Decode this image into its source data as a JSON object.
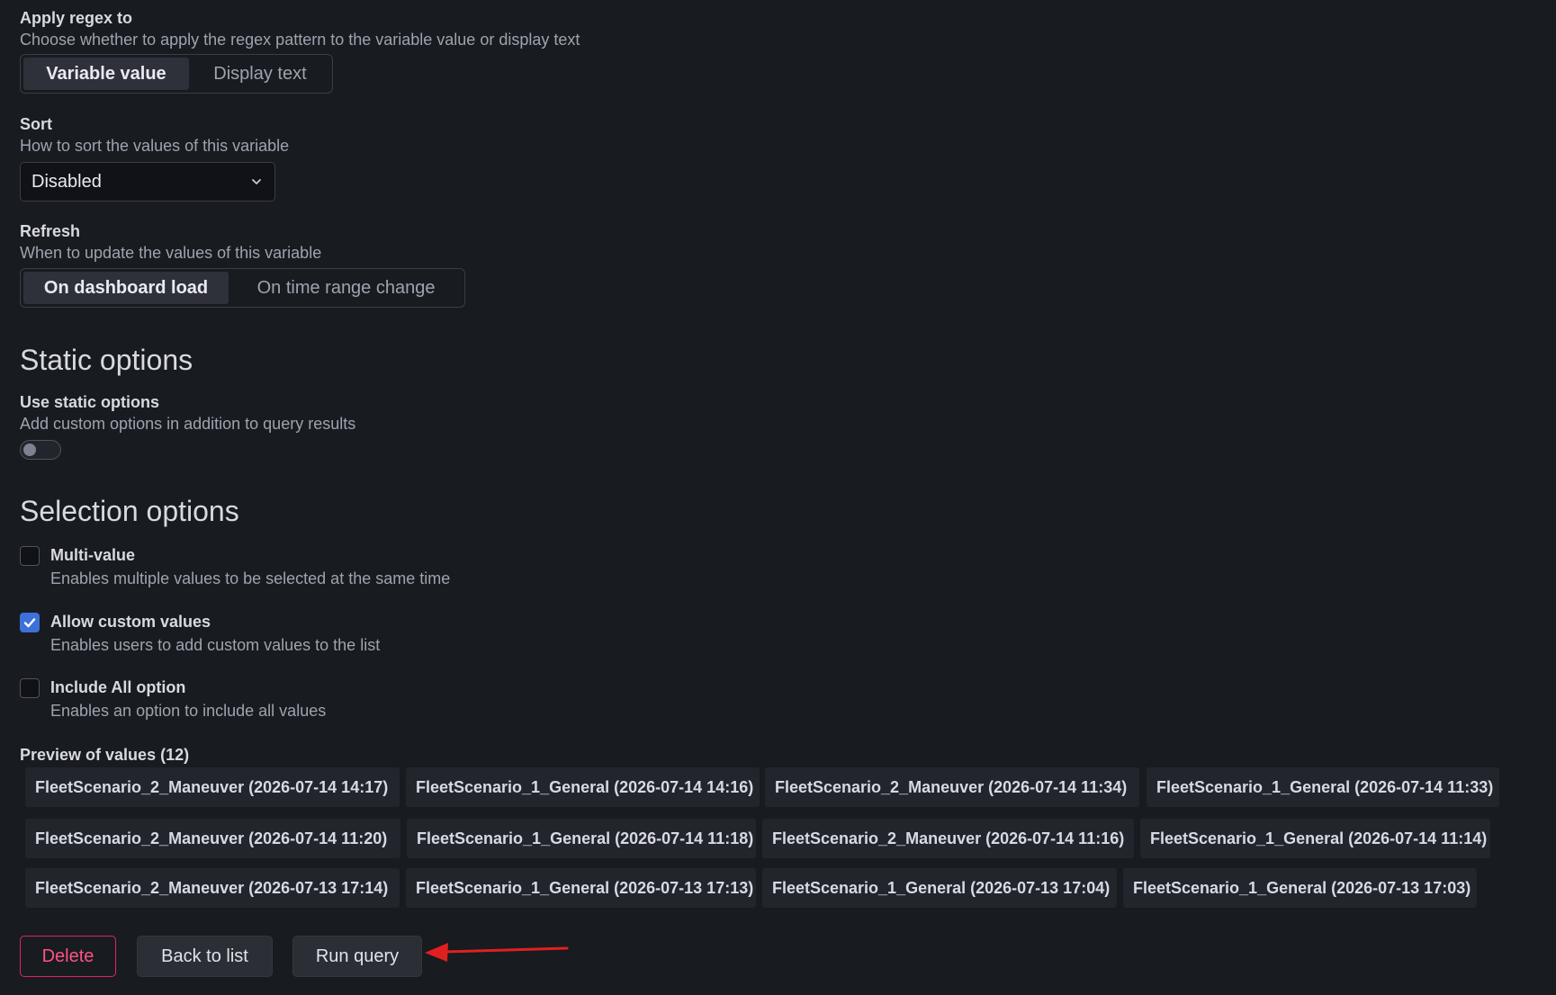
{
  "regex": {
    "label": "Apply regex to",
    "description": "Choose whether to apply the regex pattern to the variable value or display text",
    "options": [
      "Variable value",
      "Display text"
    ],
    "selected": "Variable value"
  },
  "sort": {
    "label": "Sort",
    "description": "How to sort the values of this variable",
    "value": "Disabled"
  },
  "refresh": {
    "label": "Refresh",
    "description": "When to update the values of this variable",
    "options": [
      "On dashboard load",
      "On time range change"
    ],
    "selected": "On dashboard load"
  },
  "static_options": {
    "title": "Static options",
    "toggle_label": "Use static options",
    "toggle_description": "Add custom options in addition to query results",
    "enabled": false
  },
  "selection_options": {
    "title": "Selection options",
    "items": [
      {
        "label": "Multi-value",
        "description": "Enables multiple values to be selected at the same time",
        "checked": false
      },
      {
        "label": "Allow custom values",
        "description": "Enables users to add custom values to the list",
        "checked": true
      },
      {
        "label": "Include All option",
        "description": "Enables an option to include all values",
        "checked": false
      }
    ]
  },
  "preview": {
    "label": "Preview of values (12)",
    "values": [
      "FleetScenario_2_Maneuver (2026-07-14 14:17)",
      "FleetScenario_1_General (2026-07-14 14:16)",
      "FleetScenario_2_Maneuver (2026-07-14 11:34)",
      "FleetScenario_1_General (2026-07-14 11:33)",
      "FleetScenario_2_Maneuver (2026-07-14 11:20)",
      "FleetScenario_1_General (2026-07-14 11:18)",
      "FleetScenario_2_Maneuver (2026-07-14 11:16)",
      "FleetScenario_1_General (2026-07-14 11:14)",
      "FleetScenario_2_Maneuver (2026-07-13 17:14)",
      "FleetScenario_1_General (2026-07-13 17:13)",
      "FleetScenario_1_General (2026-07-13 17:04)",
      "FleetScenario_1_General (2026-07-13 17:03)"
    ]
  },
  "actions": {
    "delete": "Delete",
    "back": "Back to list",
    "run": "Run query"
  },
  "colors": {
    "background": "#181b1f",
    "accent_blue": "#3d71d9",
    "danger": "#ff5286",
    "annotation_arrow": "#e02020"
  }
}
